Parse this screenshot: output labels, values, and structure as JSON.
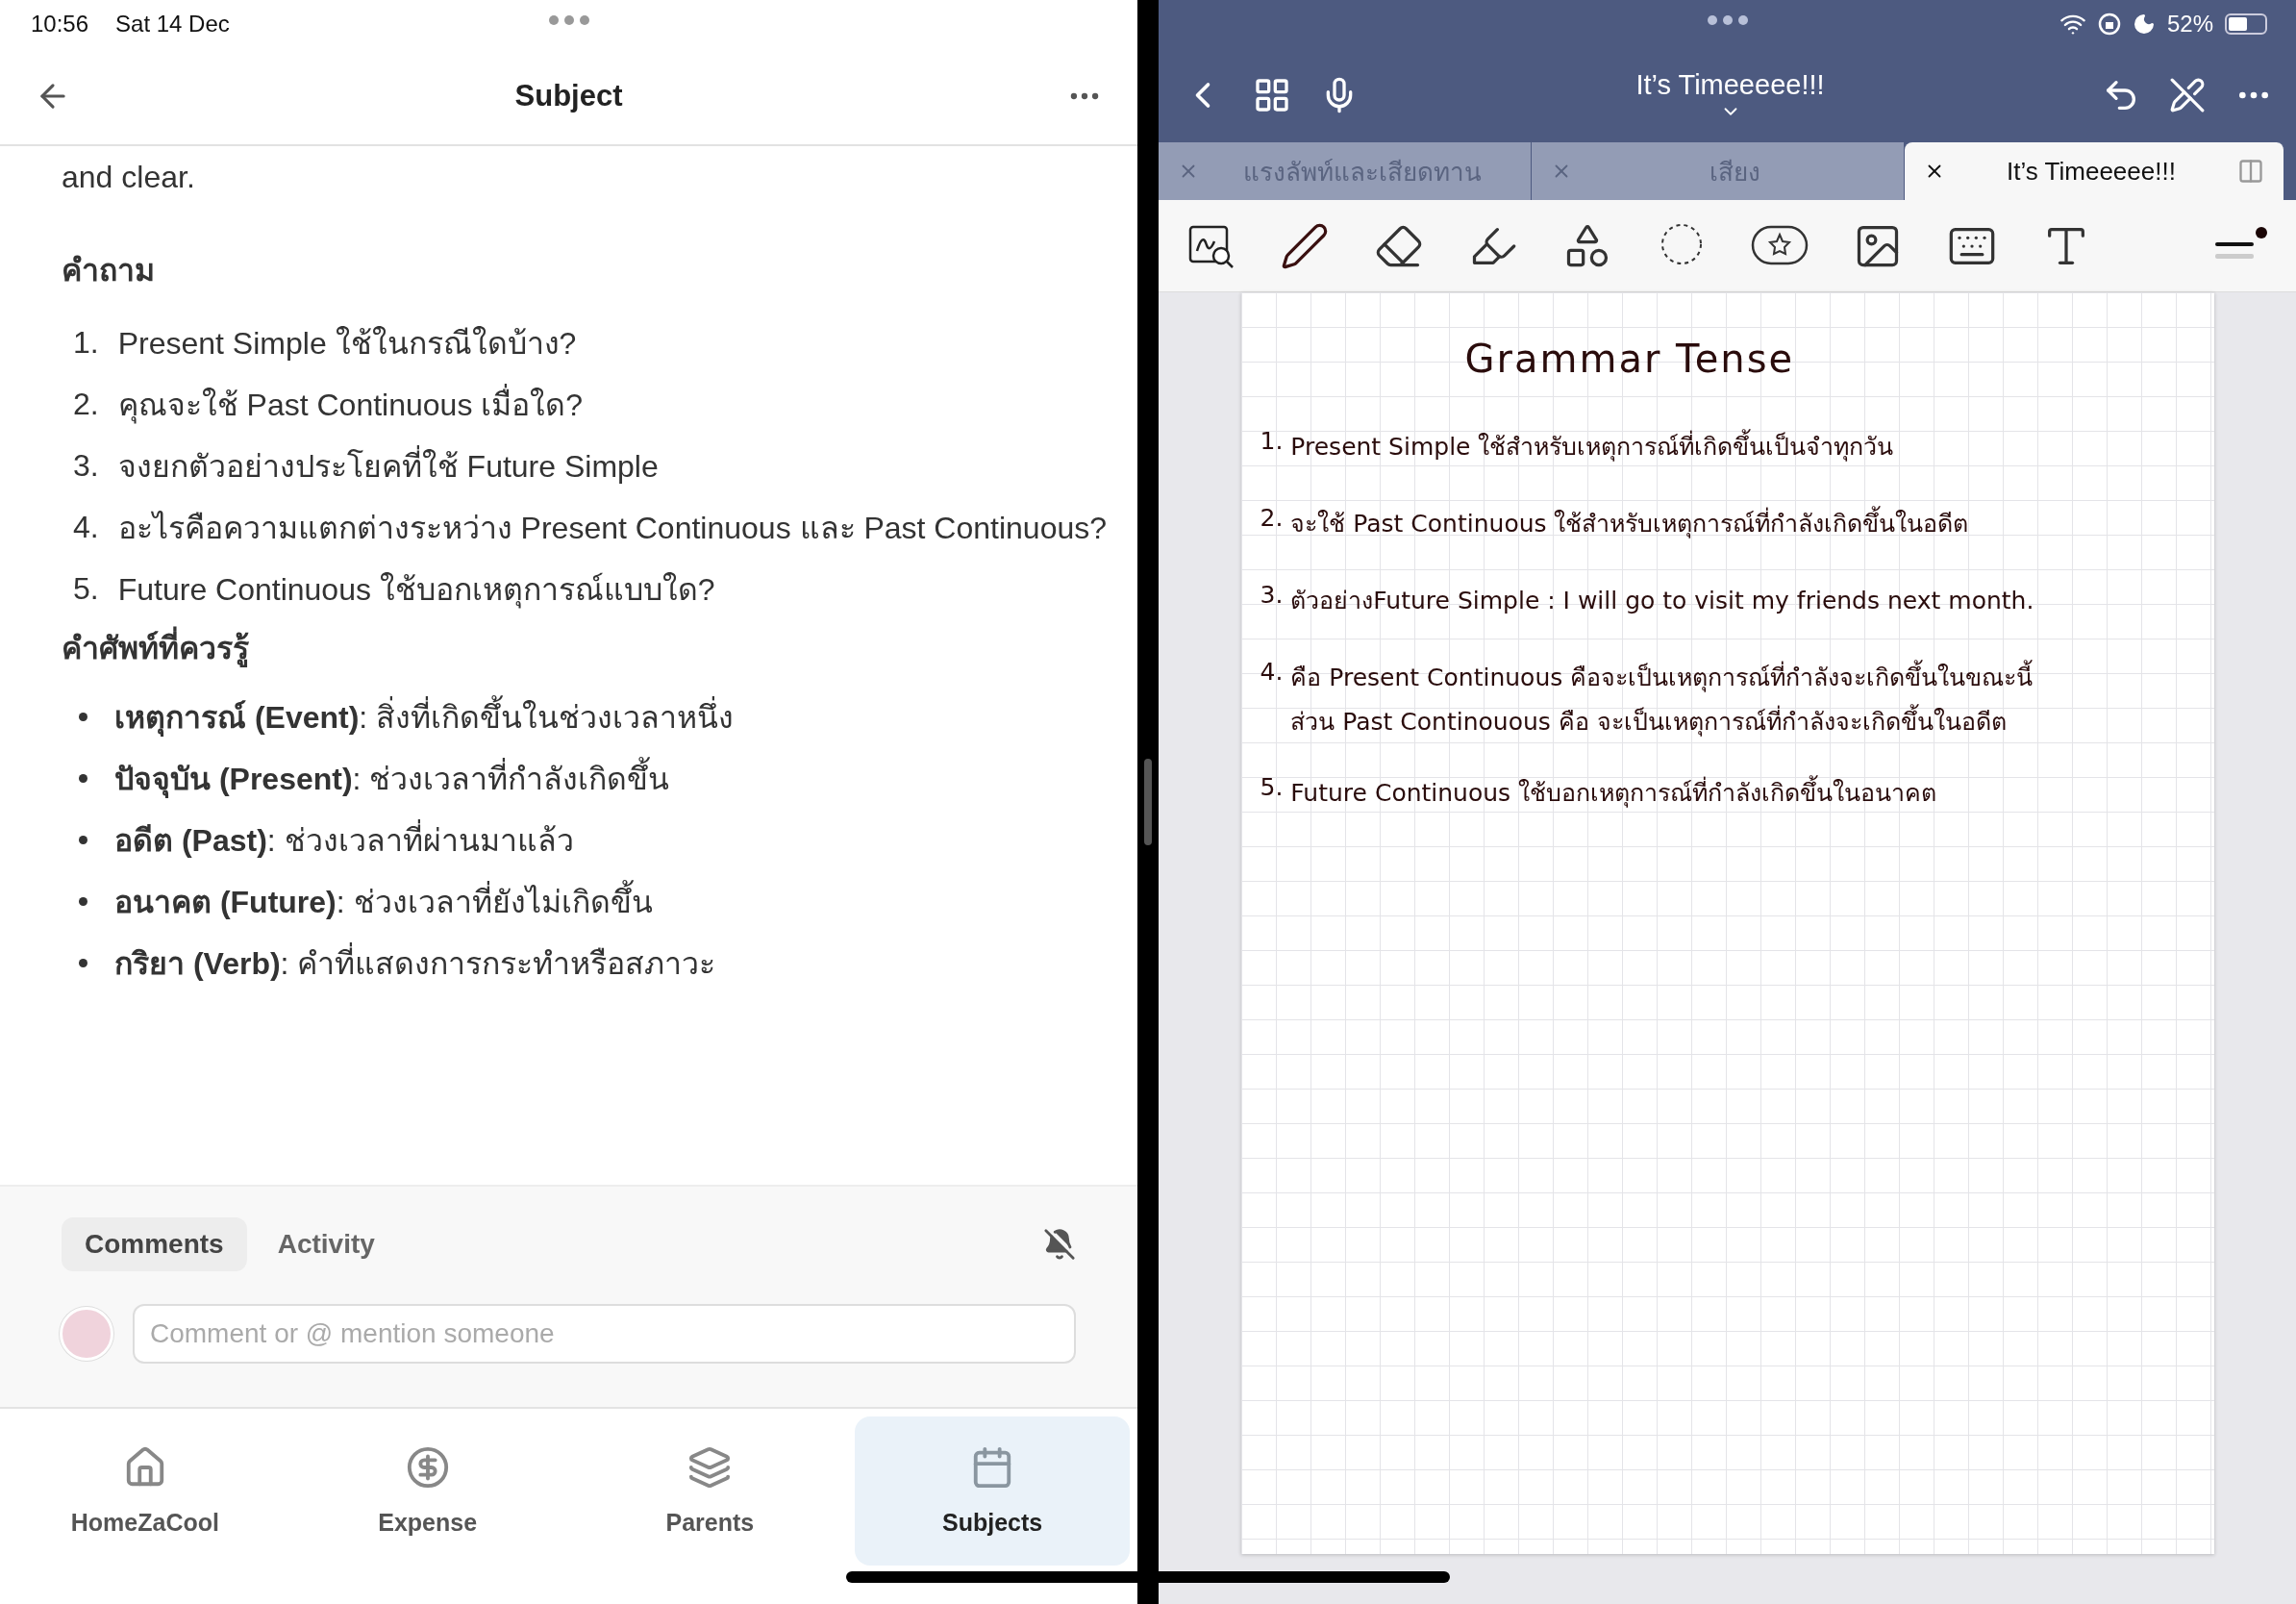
{
  "status_bar": {
    "time": "10:56",
    "date": "Sat 14 Dec",
    "battery": "52%"
  },
  "left": {
    "header": {
      "title": "Subject"
    },
    "body": {
      "intro_tail": "and clear.",
      "questions_heading": "คำถาม",
      "questions": [
        {
          "number": "1.",
          "text": "Present Simple ใช้ในกรณีใดบ้าง?"
        },
        {
          "number": "2.",
          "text": "คุณจะใช้ Past Continuous เมื่อใด?"
        },
        {
          "number": "3.",
          "text": "จงยกตัวอย่างประโยคที่ใช้ Future Simple"
        },
        {
          "number": "4.",
          "text": "อะไรคือความแตกต่างระหว่าง Present Continuous และ Past Continuous?"
        },
        {
          "number": "5.",
          "text": "Future Continuous ใช้บอกเหตุการณ์แบบใด?"
        }
      ],
      "vocab_heading": "คำศัพท์ที่ควรรู้",
      "vocab": [
        "**เหตุการณ์ (Event)**: สิ่งที่เกิดขึ้นในช่วงเวลาหนึ่ง",
        "**ปัจจุบัน (Present)**: ช่วงเวลาที่กำลังเกิดขึ้น",
        "**อดีต (Past)**: ช่วงเวลาที่ผ่านมาแล้ว",
        "**อนาคต (Future)**: ช่วงเวลาที่ยังไม่เกิดขึ้น",
        "**กริยา (Verb)**: คำที่แสดงการกระทำหรือสภาวะ"
      ]
    },
    "comments": {
      "tabs": [
        {
          "label": "Comments",
          "selected": true
        },
        {
          "label": "Activity",
          "selected": false
        }
      ],
      "input": {
        "placeholder": "Comment or @ mention someone"
      }
    },
    "nav": [
      {
        "label": "HomeZaCool",
        "selected": false
      },
      {
        "label": "Expense",
        "selected": false
      },
      {
        "label": "Parents",
        "selected": false
      },
      {
        "label": "Subjects",
        "selected": true
      }
    ]
  },
  "right": {
    "title": "It’s Timeeeee!!!",
    "tabs": [
      {
        "label": "แรงลัพท์และเสียดทาน",
        "selected": false
      },
      {
        "label": "เสียง",
        "selected": false
      },
      {
        "label": "It’s Timeeeee!!!",
        "selected": true
      }
    ],
    "note": {
      "title": "Grammar Tense",
      "items": [
        {
          "number": "1.",
          "lines": [
            "Present Simple ใช้สำหรับเหตุการณ์ที่เกิดขึ้นเป็นจำทุกวัน"
          ]
        },
        {
          "number": "2.",
          "lines": [
            "จะใช้ Past Continuous ใช้สำหรับเหตุการณ์ที่กำลังเกิดขึ้นในอดีต"
          ]
        },
        {
          "number": "3.",
          "lines": [
            "ตัวอย่างFuture Simple : I will go to visit my friends next month."
          ]
        },
        {
          "number": "4.",
          "lines": [
            "คือ Present Continuous คือจะเป็นเหตุการณ์ที่กำลังจะเกิดขึ้นในขณะนี้",
            "ส่วน Past Continouous คือ จะเป็นเหตุการณ์ที่กำลังจะเกิดขึ้นในอดีต"
          ]
        },
        {
          "number": "5.",
          "lines": [
            "Future Continuous ใช้บอกเหตุการณ์ที่กำลังเกิดขึ้นในอนาคต"
          ]
        }
      ]
    }
  }
}
